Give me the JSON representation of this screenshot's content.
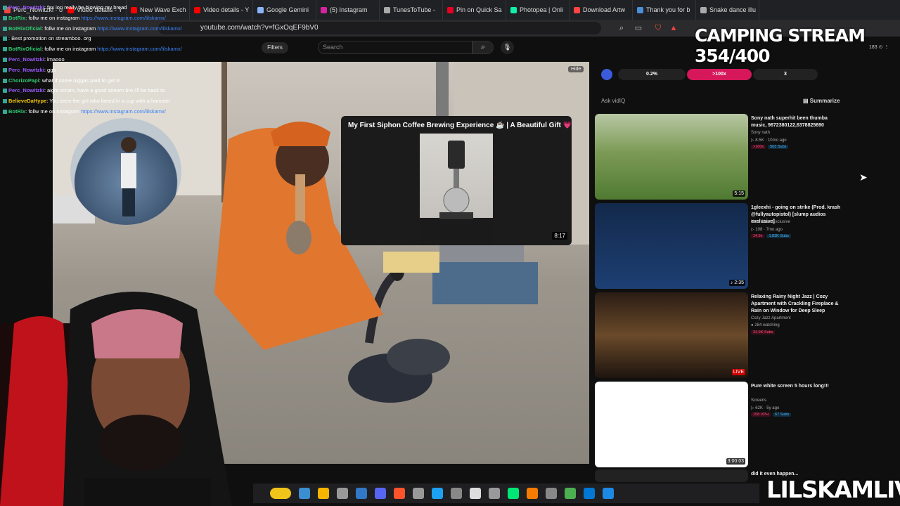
{
  "browser": {
    "tabs": [
      {
        "label": "Perc_Nowitzki · ozon zelda",
        "color": "#e44"
      },
      {
        "label": "Video details - Y",
        "color": "#f00"
      },
      {
        "label": "New Wave Exch",
        "color": "#f00"
      },
      {
        "label": "Video details - Y",
        "color": "#f00"
      },
      {
        "label": "Google Gemini",
        "color": "#8ab4f8"
      },
      {
        "label": "(5) Instagram",
        "color": "#d6249f"
      },
      {
        "label": "TunesToTube -",
        "color": "#aaa"
      },
      {
        "label": "Pin on Quick Sa",
        "color": "#e60023"
      },
      {
        "label": "Photopea | Onli",
        "color": "#1ea"
      },
      {
        "label": "Download Artw",
        "color": "#f44"
      },
      {
        "label": "Thank you for b",
        "color": "#4a90d9"
      },
      {
        "label": "Snake dance illu",
        "color": "#aaa"
      }
    ],
    "url": "youtube.com/watch?v=fGxOqEF9bV0"
  },
  "youtube": {
    "filters_label": "Filters",
    "search_placeholder": "Search",
    "hide_label": "Hide",
    "miniplayer": {
      "title": "My First Siphon Coffee Brewing Experience ☕ | A Beautiful Gift 💗",
      "duration": "8:17"
    },
    "vidiq": {
      "pill1": "0.2%",
      "pill2": ">100x",
      "pill3": "3",
      "ask": "Ask vidIQ",
      "summarize": "Summarize"
    },
    "recommendations": [
      {
        "title": "Sony nath superhit been thumba music, 9672380122,6378825690",
        "channel": "Sony nath",
        "stats": "▷ 8.5K · 10mo ago",
        "tag1": ">100x",
        "tag2": "503 Subs",
        "duration": "5:15"
      },
      {
        "title": "1gleexhi - going on strike (Prod. krash @fullyautopistol) [slump audios exclusive]",
        "channel": "New Wave Exclusive",
        "stats": "▷ 108 · 7mo ago",
        "tag1": "14.9x",
        "tag2": "1.83K Subs",
        "duration": "♪ 2:35"
      },
      {
        "title": "Relaxing Rainy Night Jazz | Cozy Apartment with Crackling Fireplace & Rain on Window for Deep Sleep",
        "channel": "Cozy Jazz Apartment",
        "stats": "● 284 watching",
        "tag1": "34.9K Subs",
        "tag2": "",
        "duration": "LIVE"
      },
      {
        "title": "Pure white screen 5 hours long!!!",
        "channel": "Screens",
        "stats": "▷ 62K · 5y ago",
        "tag1": "158 VPH",
        "tag2": "67 Subs",
        "duration": "3:00:03"
      },
      {
        "title": "did it even happen...",
        "channel": "",
        "stats": "",
        "tag1": "",
        "tag2": "",
        "duration": ""
      }
    ]
  },
  "chat": [
    {
      "user": "Perc_Nowitzki",
      "msg": ": fax ion really be blowing my bread",
      "color": "#9b59ff"
    },
    {
      "user": "BotRix",
      "msg": ": follw me on instagram ",
      "link": "https://www.instagram.com/lilskamx/",
      "color": "#2ecc71"
    },
    {
      "user": "BotRixOficial",
      "msg": ": follw me on instagram ",
      "link": "https://www.instagram.com/lilskamx/",
      "color": "#2ecc71"
    },
    {
      "user": "",
      "msg": ": Best promotion on streamboo. org",
      "color": "#9b59ff"
    },
    {
      "user": "BotRixOficial",
      "msg": ": follw me on instagram ",
      "link": "https://www.instagram.com/lilskamx/",
      "color": "#2ecc71"
    },
    {
      "user": "Perc_Nowitzki",
      "msg": ": lmaooo",
      "color": "#9b59ff"
    },
    {
      "user": "Perc_Nowitzki",
      "msg": ": ggs",
      "color": "#9b59ff"
    },
    {
      "user": "ChorizoPapi",
      "msg": ": what if some niggas paid to get in",
      "color": "#2ecc71"
    },
    {
      "user": "Perc_Nowitzki",
      "msg": ": aight scram, have a good stream bro i'll be back to",
      "color": "#9b59ff"
    },
    {
      "user": "BelieveDaHype",
      "msg": ": You seen the girl who farted in a cup with a hamster",
      "color": "#f1c40f"
    },
    {
      "user": "BotRix",
      "msg": ": follw me on instagram ",
      "link": "https://www.instagram.com/lilskamx/",
      "color": "#2ecc71"
    }
  ],
  "overlay": {
    "camping": "CAMPING STREAM 354/400",
    "brand": "LILSKAMLIVE",
    "counters": "183  ⊙  ⋮"
  },
  "taskbar_icons": [
    "#f0c419",
    "#3b8ed0",
    "#f6b500",
    "#999",
    "#3178c6",
    "#5865f2",
    "#fb542b",
    "#999",
    "#1da1f2",
    "#888",
    "#ddd",
    "#999",
    "#00e676",
    "#f57c00",
    "#888",
    "#4caf50",
    "#0078d4",
    "#1e88e5"
  ]
}
